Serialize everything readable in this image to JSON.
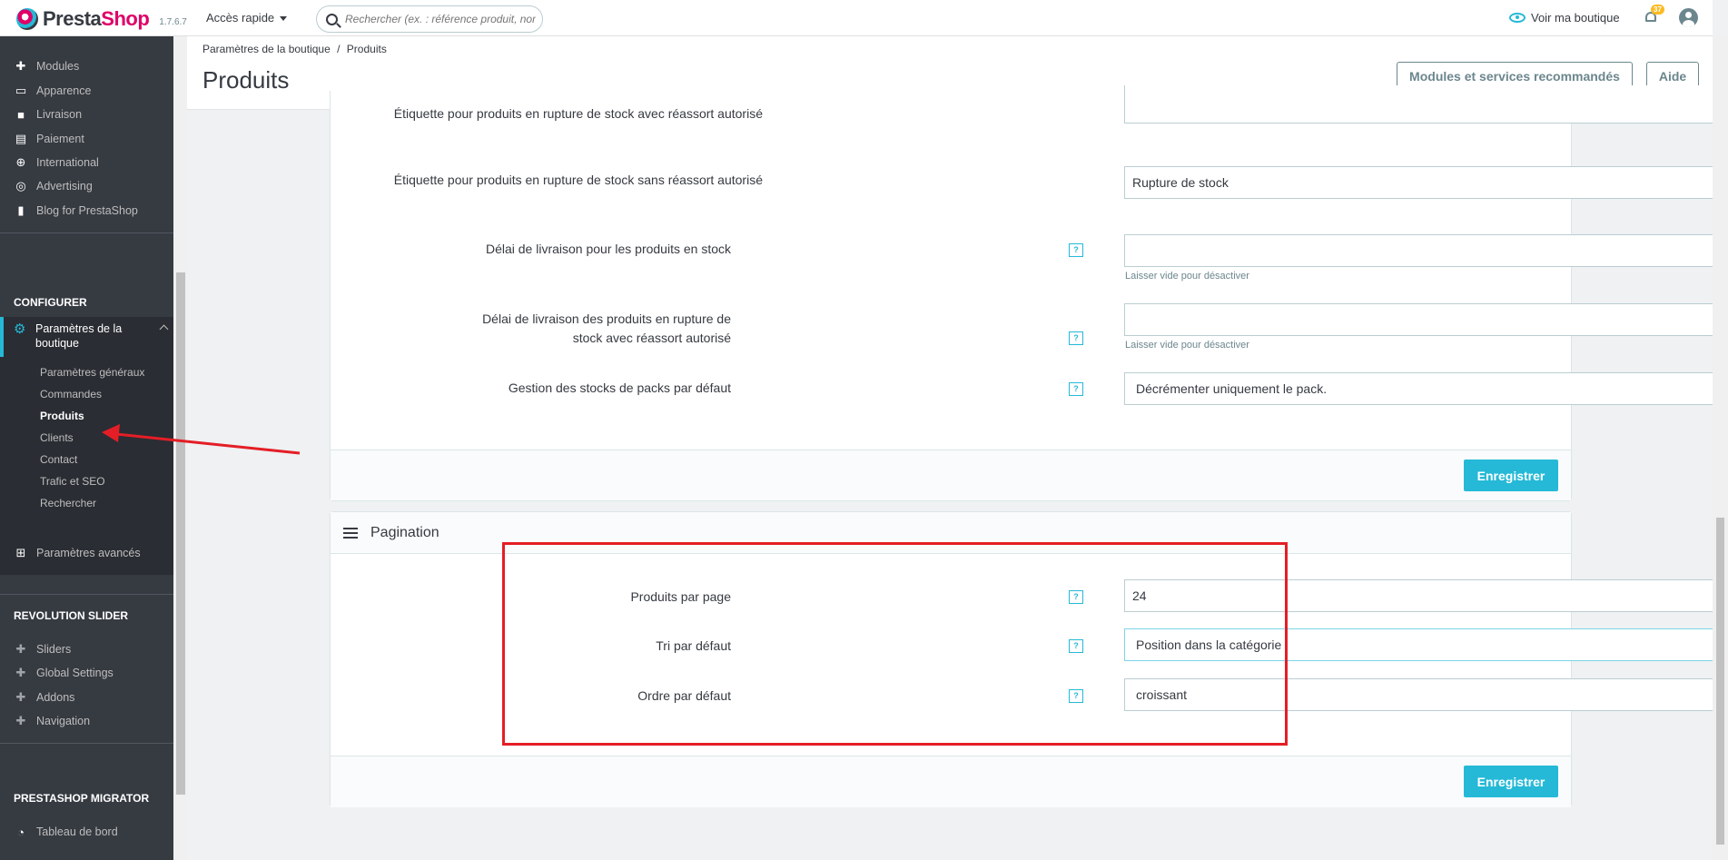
{
  "topbar": {
    "logo_text_a": "Presta",
    "logo_text_b": "Shop",
    "version": "1.7.6.7",
    "quick_access": "Accès rapide",
    "search_placeholder": "Rechercher (ex. : référence produit, nom",
    "view_shop": "Voir ma boutique",
    "notifications_count": "37"
  },
  "sidebar": {
    "top_items": [
      "Modules",
      "Apparence",
      "Livraison",
      "Paiement",
      "International",
      "Advertising",
      "Blog for PrestaShop"
    ],
    "configure_heading": "CONFIGURER",
    "active_item": "Paramètres de la boutique",
    "sub_items": [
      "Paramètres généraux",
      "Commandes",
      "Produits",
      "Clients",
      "Contact",
      "Trafic et SEO",
      "Rechercher"
    ],
    "advanced": "Paramètres avancés",
    "revslider_heading": "REVOLUTION SLIDER",
    "revslider_items": [
      "Sliders",
      "Global Settings",
      "Addons",
      "Navigation"
    ],
    "migrator_heading": "PRESTASHOP MIGRATOR",
    "migrator_items": [
      "Tableau de bord"
    ]
  },
  "header": {
    "breadcrumb_parent": "Paramètres de la boutique",
    "breadcrumb_sep": "/",
    "breadcrumb_current": "Produits",
    "title": "Produits",
    "recommended_button": "Modules et services recommandés",
    "help_button": "Aide"
  },
  "stock_panel": {
    "label_oos_allowed": "Étiquette pour produits en rupture de stock avec réassort autorisé",
    "label_oos_denied": "Étiquette pour produits en rupture de stock sans réassort autorisé",
    "value_oos_denied": "Rupture de stock",
    "label_delay_in_stock": "Délai de livraison pour les produits en stock",
    "label_delay_oos": "Délai de livraison des produits en rupture de stock avec réassort autorisé",
    "hint_disable": "Laisser vide pour désactiver",
    "label_pack_stock": "Gestion des stocks de packs par défaut",
    "value_pack_stock": "Décrémenter uniquement le pack.",
    "save": "Enregistrer"
  },
  "pagination_panel": {
    "title": "Pagination",
    "label_per_page": "Produits par page",
    "value_per_page": "24",
    "label_sort": "Tri par défaut",
    "value_sort": "Position dans la catégorie",
    "label_order": "Ordre par défaut",
    "value_order": "croissant",
    "save": "Enregistrer"
  },
  "help_glyph": "?",
  "colors": {
    "accent": "#25b9d7",
    "sidebar": "#363a41",
    "annotation": "#e41e26",
    "brand": "#df0067"
  }
}
